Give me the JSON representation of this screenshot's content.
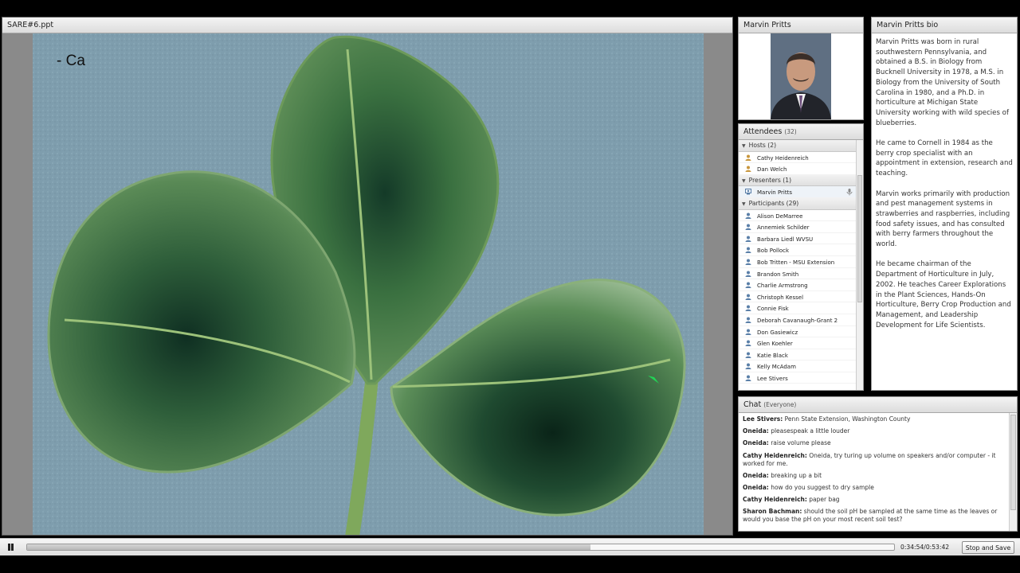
{
  "slide_pod": {
    "title": "SARE#6.ppt",
    "slide_text": "- Ca"
  },
  "camera_pod": {
    "title": "Marvin Pritts"
  },
  "bio_pod": {
    "title": "Marvin Pritts bio",
    "paragraphs": [
      "Marvin Pritts was born in rural southwestern Pennsylvania, and obtained a B.S. in Biology from Bucknell University in 1978, a M.S. in Biology from the University of South Carolina in 1980, and a Ph.D. in horticulture at Michigan State University working with wild species of blueberries.",
      "He came to Cornell in 1984 as the berry crop specialist with an appointment in extension, research and teaching.",
      "Marvin works primarily with production and pest management systems in strawberries and raspberries, including food safety issues, and has consulted with berry farmers throughout the world.",
      "He became chairman of the Department of Horticulture in July, 2002. He teaches Career Explorations in the Plant Sciences, Hands-On Horticulture, Berry Crop Production and Management, and Leadership Development for Life Scientists."
    ]
  },
  "attendees_pod": {
    "title": "Attendees",
    "count": "(32)",
    "hosts_label": "Hosts (2)",
    "hosts": [
      "Cathy  Heidenreich",
      "Dan Welch"
    ],
    "presenters_label": "Presenters (1)",
    "presenters": [
      "Marvin Pritts"
    ],
    "participants_label": "Participants (29)",
    "participants": [
      "Alison DeMarree",
      "Annemiek Schilder",
      "Barbara Liedl WVSU",
      "Bob Pollock",
      "Bob Tritten - MSU Extension",
      "Brandon Smith",
      "Charlie Armstrong",
      "Christoph Kessel",
      "Connie Fisk",
      "Deborah Cavanaugh-Grant 2",
      "Don Gasiewicz",
      "Glen Koehler",
      "Katie Black",
      "Kelly McAdam",
      "Lee Stivers"
    ]
  },
  "chat_pod": {
    "title": "Chat",
    "scope": "(Everyone)",
    "messages": [
      {
        "who": "Lee Stivers:",
        "text": "Penn State Extension, Washington County"
      },
      {
        "who": "Oneida:",
        "text": "pleasespeak a little louder"
      },
      {
        "who": "Oneida:",
        "text": "raise volume please"
      },
      {
        "who": "Cathy  Heidenreich:",
        "text": "Oneida, try turing up volume on speakers and/or computer - it worked for me."
      },
      {
        "who": "Oneida:",
        "text": "breaking up a bit"
      },
      {
        "who": "Oneida:",
        "text": "how do you suggest to dry sample"
      },
      {
        "who": "Cathy  Heidenreich:",
        "text": "paper bag"
      },
      {
        "who": "Sharon Bachman:",
        "text": "should the soil pH be sampled at the same time as the leaves or would you base the pH on your most recent soil test?"
      }
    ]
  },
  "playback": {
    "time": "0:34:54/0:53:42",
    "progress": 0.65,
    "stop_label": "Stop and Save"
  }
}
